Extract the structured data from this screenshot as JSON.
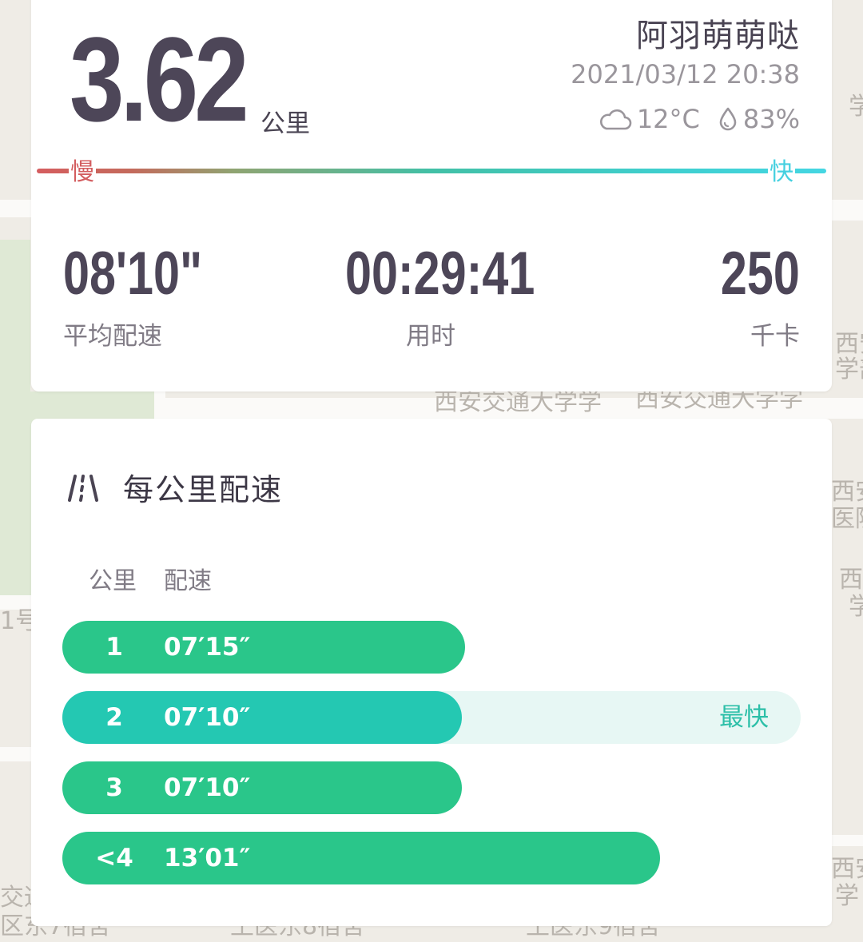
{
  "summary": {
    "distance": "3.62",
    "distance_unit": "公里",
    "user_name": "阿羽萌萌哒",
    "datetime": "2021/03/12 20:38",
    "temperature": "12°C",
    "humidity": "83%",
    "weather_icon": "cloud-icon",
    "humidity_icon": "water-drop-icon",
    "pace_scale": {
      "slow_label": "慢",
      "fast_label": "快"
    }
  },
  "stats": [
    {
      "value": "08'10\"",
      "label": "平均配速"
    },
    {
      "value": "00:29:41",
      "label": "用时"
    },
    {
      "value": "250",
      "label": "千卡"
    }
  ],
  "splits": {
    "title": "每公里配速",
    "icon": "road-icon",
    "col_km": "公里",
    "col_pace": "配速",
    "fastest_label": "最快",
    "rows": [
      {
        "km": "1",
        "pace": "07′15″",
        "seconds": 435,
        "fastest": false
      },
      {
        "km": "2",
        "pace": "07′10″",
        "seconds": 430,
        "fastest": true
      },
      {
        "km": "3",
        "pace": "07′10″",
        "seconds": 430,
        "fastest": false
      },
      {
        "km": "<4",
        "pace": "13′01″",
        "seconds": 781,
        "fastest": false
      }
    ]
  },
  "map": {
    "labels": [
      "西安交通大学学",
      "西安交通大学学",
      "学",
      "西安",
      "学部",
      "西安",
      "医院",
      "西",
      "学",
      "1号",
      "交通",
      "区东7宿舍",
      "王医东8宿舍",
      "王医东9宿舍",
      "西安",
      "学"
    ]
  },
  "colors": {
    "slow": "#d55d5f",
    "fast": "#45d6e2",
    "split_bar": "#2ac68a",
    "fastest_bar": "#24c8b2"
  }
}
